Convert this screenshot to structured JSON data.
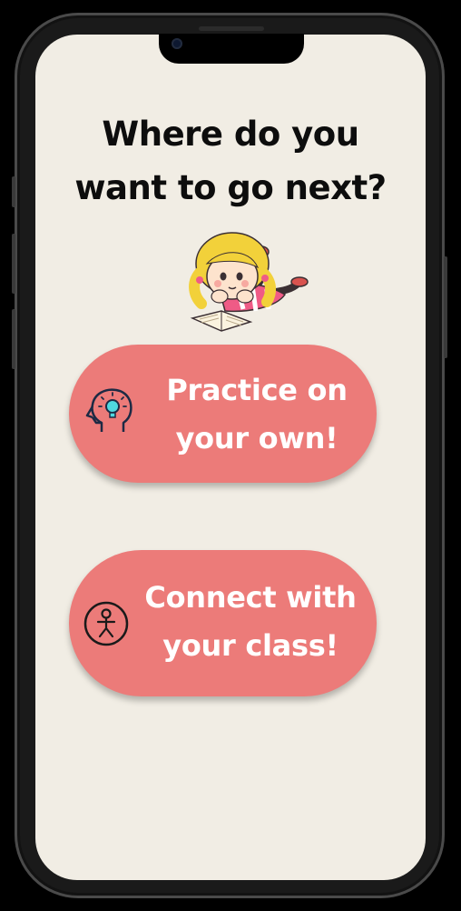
{
  "heading": {
    "line1": "Where do you",
    "line2": "want to go next?"
  },
  "illustration": "girl-reading-book",
  "options": [
    {
      "line1": "Practice on",
      "line2": "your own!",
      "icon": "head-lightbulb-icon"
    },
    {
      "line1": "Connect with",
      "line2": "your class!",
      "icon": "person-circle-icon"
    }
  ],
  "colors": {
    "background": "#f1ede4",
    "button": "#ec7b79",
    "button_text": "#ffffff",
    "heading_text": "#0d0d0d"
  }
}
